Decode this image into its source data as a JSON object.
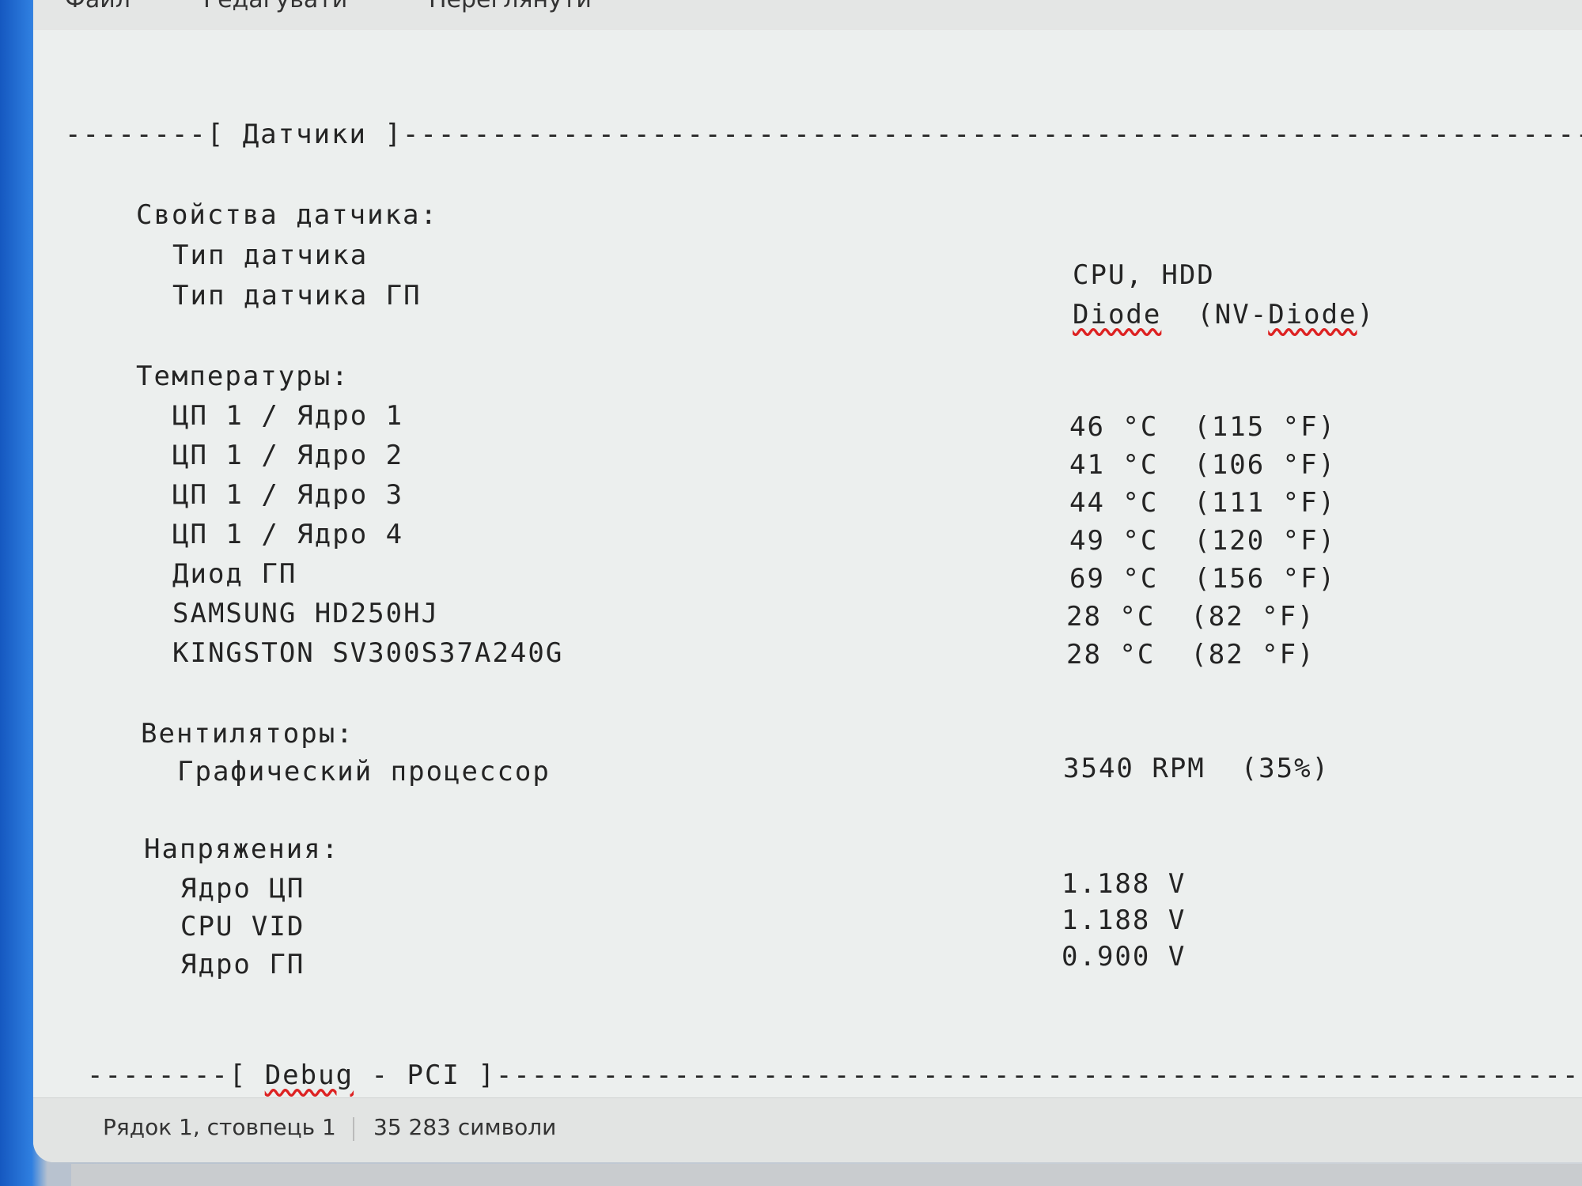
{
  "menu": {
    "file": "Файл",
    "edit": "Редагувати",
    "view": "Переглянути"
  },
  "editor": {
    "section_sensors_header": "--------[ Датчики ]--------------------------------------------------------------------------",
    "sensor_props_title": "Свойства датчика:",
    "sensor_type_label": "Тип датчика",
    "sensor_type_value": "CPU, HDD",
    "gpu_sensor_type_label": "Тип датчика ГП",
    "gpu_sensor_type_value_a": "Diode",
    "gpu_sensor_type_value_b": "(NV-",
    "gpu_sensor_type_value_c": "Diode",
    "gpu_sensor_type_value_d": ")",
    "temps_title": "Температуры:",
    "temps": [
      {
        "label": "ЦП 1 / Ядро 1",
        "value": "46 °C  (115 °F)"
      },
      {
        "label": "ЦП 1 / Ядро 2",
        "value": "41 °C  (106 °F)"
      },
      {
        "label": "ЦП 1 / Ядро 3",
        "value": "44 °C  (111 °F)"
      },
      {
        "label": "ЦП 1 / Ядро 4",
        "value": "49 °C  (120 °F)"
      },
      {
        "label": "Диод ГП",
        "value": "69 °C  (156 °F)"
      },
      {
        "label": "SAMSUNG HD250HJ",
        "value": "28 °C  (82 °F)"
      },
      {
        "label": "KINGSTON SV300S37A240G",
        "value": "28 °C  (82 °F)"
      }
    ],
    "fans_title": "Вентиляторы:",
    "fan_gpu_label": "Графический процессор",
    "fan_gpu_value": "3540 RPM  (35%)",
    "volts_title": "Напряжения:",
    "volts": [
      {
        "label": "Ядро ЦП",
        "value": "1.188 V"
      },
      {
        "label": "CPU VID",
        "value": "1.188 V"
      },
      {
        "label": "Ядро ГП",
        "value": "0.900 V"
      }
    ],
    "section_debug_prefix": "--------[ ",
    "section_debug_word": "Debug",
    "section_debug_suffix": " - PCI ]------------------------------------------------------------------------"
  },
  "status": {
    "position": "Рядок 1, стовпець 1",
    "chars": "35 283 символи"
  }
}
